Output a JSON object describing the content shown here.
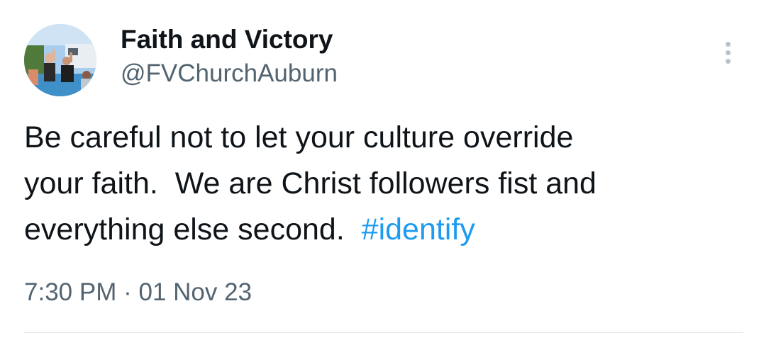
{
  "tweet": {
    "author": {
      "display_name": "Faith and Victory",
      "handle": "@FVChurchAuburn",
      "avatar_icon": "profile-photo-baptism"
    },
    "more_icon": "more-vertical-icon",
    "text": {
      "line1": "Be careful not to let your culture override",
      "line2": "your faith.  We are Christ followers fist and",
      "line3_prefix": "everything else second.  ",
      "hashtag": "#identify"
    },
    "timestamp": {
      "time": "7:30 PM",
      "separator": "·",
      "date": "01 Nov 23"
    }
  },
  "colors": {
    "text_primary": "#0f1419",
    "text_secondary": "#536471",
    "link": "#1d9bf0",
    "divider": "#e3e8ec"
  }
}
